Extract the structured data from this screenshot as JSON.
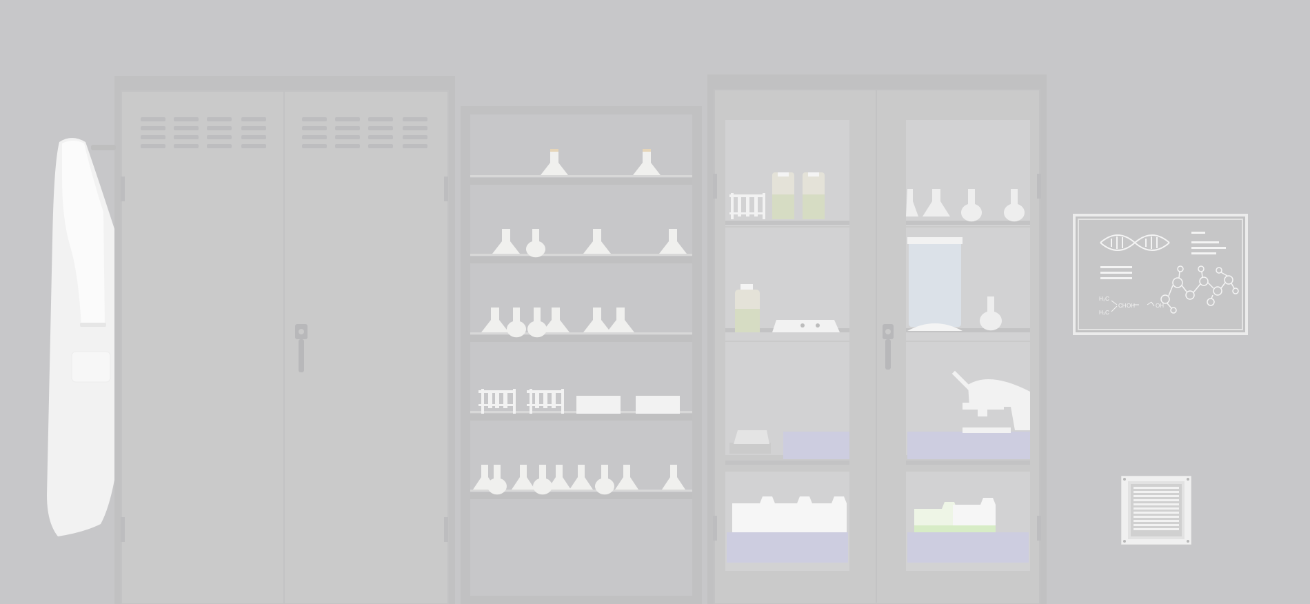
{
  "scene": {
    "name": "Laboratory room",
    "colors": {
      "wall": "#c7c7c9",
      "cabinet": "#cacaca",
      "cabinet_edge": "#c1c1c2",
      "glass_panel": "#d2d2d3",
      "tray": "#cdcde0",
      "white": "#f6f6f6"
    }
  },
  "objects": {
    "lab_coat": {
      "icon": "lab-coat-icon"
    },
    "locker": {
      "icon": "locker-icon"
    },
    "open_shelf": {
      "icon": "shelf-icon"
    },
    "glass_cabinet": {
      "icon": "glass-cabinet-icon"
    },
    "whiteboard": {
      "icon": "whiteboard-icon",
      "formula_1": "H₃C",
      "formula_2": "CH",
      "formula_3": "OH",
      "formula_4": "H₃C"
    },
    "air_vent": {
      "icon": "vent-icon"
    }
  }
}
